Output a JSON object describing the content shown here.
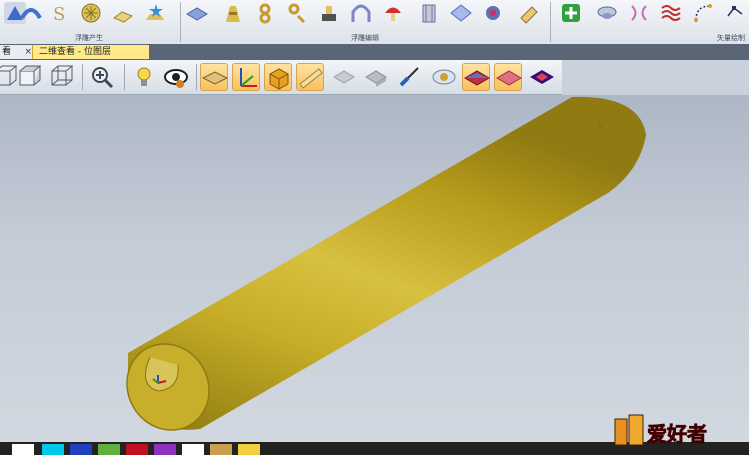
{
  "ribbon": {
    "groups": [
      {
        "label": "浮雕产生"
      },
      {
        "label": "浮雕编辑"
      },
      {
        "label": "矢量绘制"
      }
    ],
    "icons": [
      "import-icon",
      "sculpt-icon",
      "spiral-s-icon",
      "weave-icon",
      "smooth-icon",
      "star-pile-icon",
      "flatten-icon",
      "bridge-icon",
      "ring-icon",
      "deform-icon",
      "stamp-icon",
      "arch-icon",
      "mushroom-icon",
      "pillar-icon",
      "plane-icon",
      "orbit-icon",
      "eraser-icon",
      "add-icon",
      "bowl-icon",
      "mirror-icon",
      "wave-icon",
      "vector-curve-icon",
      "node-icon"
    ]
  },
  "tabs": [
    {
      "label": "看",
      "close": "×"
    },
    {
      "label": "二维查看 - 位图层"
    }
  ],
  "viewbar": {
    "icons": [
      "front-view-icon",
      "iso-view-icon",
      "wire-box-icon",
      "zoom-icon",
      "light-bulb-icon",
      "eye-icon",
      "plane-view-icon",
      "axes-icon",
      "box-color-icon",
      "bar-shade-icon",
      "grey-model-1-icon",
      "grey-model-2-icon",
      "brush-icon",
      "eye-shade-icon",
      "layer-red-icon",
      "layer-pink-icon",
      "layer-diamond-icon"
    ],
    "active": [
      "plane-view-icon",
      "axes-icon",
      "box-color-icon",
      "bar-shade-icon",
      "layer-red-icon",
      "layer-pink-icon"
    ]
  },
  "colors": {
    "cylinder": "#c2a820",
    "cylinder_dark": "#8e7a10",
    "cylinder_light": "#dcc44a",
    "palette": [
      "#ffffff",
      "#00c8e8",
      "#2040c0",
      "#60b040",
      "#c01020",
      "#9030c0",
      "#ffffff",
      "#c8a050",
      "#f0d040"
    ]
  },
  "watermark": {
    "text": "爱好者"
  }
}
